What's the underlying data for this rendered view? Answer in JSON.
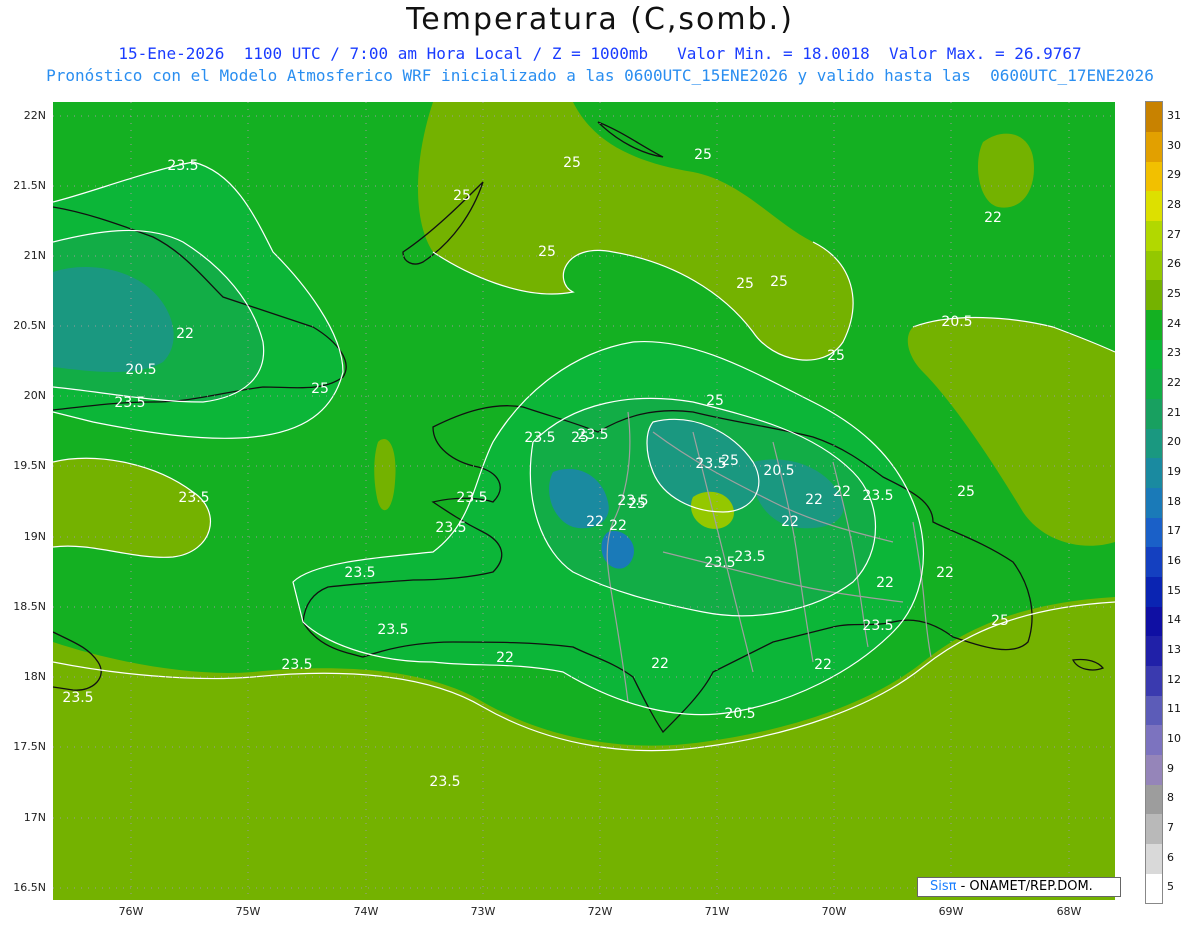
{
  "title": "Temperatura (C,somb.)",
  "subtitle_1": "15-Ene-2026  1100 UTC / 7:00 am Hora Local / Z = 1000mb   Valor Min. = 18.0018  Valor Max. = 26.9767",
  "subtitle_2": "Pronóstico con el Modelo Atmosferico WRF inicializado a las 0600UTC_15ENE2026 y valido hasta las  0600UTC_17ENE2026",
  "latitude_labels": [
    "22N",
    "21.5N",
    "21N",
    "20.5N",
    "20N",
    "19.5N",
    "19N",
    "18.5N",
    "18N",
    "17.5N",
    "17N",
    "16.5N"
  ],
  "longitude_labels": [
    "76W",
    "75W",
    "74W",
    "73W",
    "72W",
    "71W",
    "70W",
    "69W",
    "68W"
  ],
  "colorbar": {
    "levels": [
      "5",
      "6",
      "7",
      "8",
      "9",
      "10",
      "11",
      "12",
      "13",
      "14",
      "15",
      "16",
      "17",
      "18",
      "19",
      "20",
      "21",
      "22",
      "23",
      "24",
      "25",
      "26",
      "27",
      "28",
      "29",
      "30",
      "31"
    ],
    "colors": [
      "#ffffff",
      "#d9d9d9",
      "#b9b9b9",
      "#9d9d9d",
      "#9585b9",
      "#7c73bf",
      "#5c5cb8",
      "#3a3aaf",
      "#2020a8",
      "#0f0fa3",
      "#0a24b2",
      "#1440c0",
      "#1a60c8",
      "#1a7ab8",
      "#1a8aa0",
      "#1a9880",
      "#18a060",
      "#12ad46",
      "#0cb638",
      "#14b022",
      "#74b200",
      "#94c800",
      "#b2d800",
      "#dde000",
      "#f2c000",
      "#e2a000",
      "#c88200"
    ]
  },
  "contour_labels": [
    "23.5",
    "25",
    "20.5",
    "22",
    "23.5",
    "25",
    "25",
    "25",
    "25",
    "25",
    "25",
    "25",
    "22",
    "20.5",
    "23.5",
    "23.5",
    "25",
    "23.5",
    "23.5",
    "22",
    "22",
    "23.5",
    "20.5",
    "22",
    "22",
    "22",
    "23.5",
    "23.5",
    "23.5",
    "22",
    "23.5",
    "22",
    "20.5",
    "22",
    "23.5",
    "25",
    "22",
    "22",
    "23.5",
    "23.5",
    "25",
    "23.5",
    "23.5",
    "23.5",
    "23.5",
    "25",
    "25",
    "25"
  ],
  "credit": {
    "brand": "Sisπ",
    "text": " - ONAMET/REP.DOM."
  }
}
